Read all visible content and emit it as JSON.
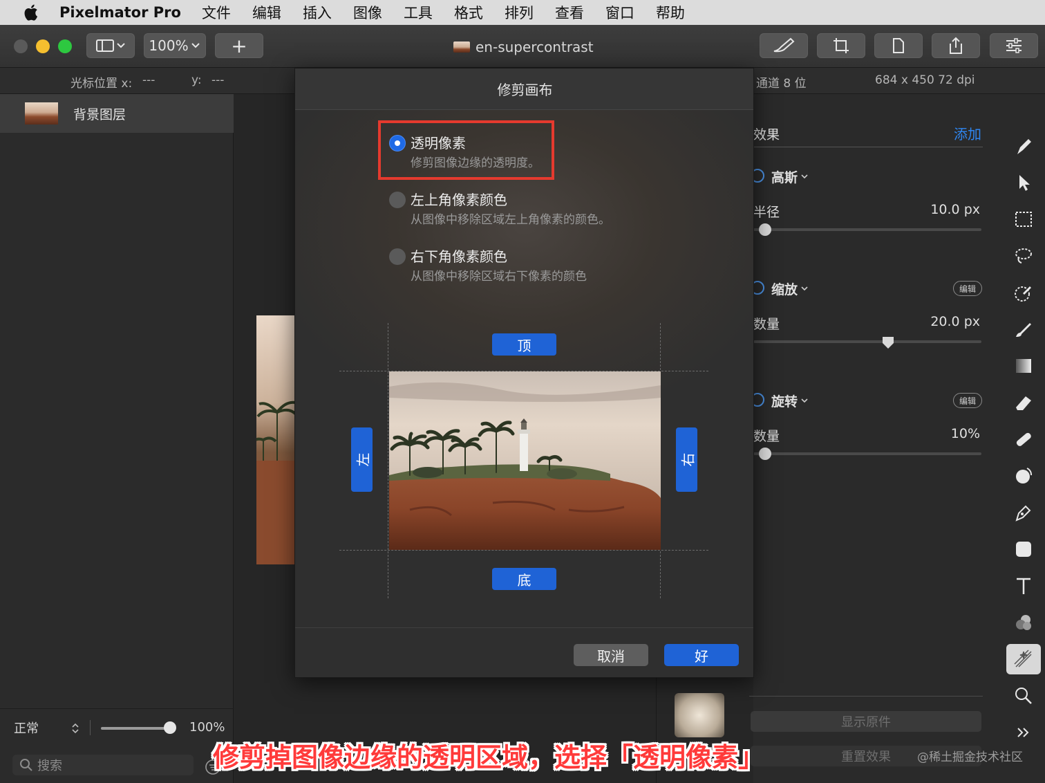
{
  "menubar": {
    "app_name": "Pixelmator Pro",
    "items": [
      "文件",
      "编辑",
      "插入",
      "图像",
      "工具",
      "格式",
      "排列",
      "查看",
      "窗口",
      "帮助"
    ]
  },
  "toolbar": {
    "zoom": "100%",
    "add_label": "+",
    "document_title": "en-supercontrast"
  },
  "infobar": {
    "cursor_x_label": "光标位置 x:",
    "cursor_x_value": "---",
    "cursor_y_label": "y:",
    "cursor_y_value": "---",
    "channel_info": "通道 8 位",
    "image_info": "684 x 450 72 dpi"
  },
  "layers": {
    "items": [
      {
        "label": "背景图层"
      }
    ],
    "blend_mode": "正常",
    "opacity": "100%",
    "opacity_fraction": 1.0,
    "search_placeholder": "搜索"
  },
  "dialog": {
    "title": "修剪画布",
    "options": [
      {
        "title": "透明像素",
        "desc": "修剪图像边缘的透明度。",
        "selected": true
      },
      {
        "title": "左上角像素颜色",
        "desc": "从图像中移除区域左上角像素的颜色。",
        "selected": false
      },
      {
        "title": "右下角像素颜色",
        "desc": "从图像中移除区域右下像素的颜色",
        "selected": false
      }
    ],
    "edges": {
      "top": "顶",
      "bottom": "底",
      "left": "左",
      "right": "右"
    },
    "cancel_label": "取消",
    "ok_label": "好"
  },
  "effects": {
    "header": "效果",
    "add_label": "添加",
    "edit_label": "编辑",
    "groups": [
      {
        "name": "高斯",
        "param_label": "半径",
        "param_value": "10.0 px",
        "level": 0.05
      },
      {
        "name": "缩放",
        "param_label": "数量",
        "param_value": "20.0 px",
        "level": 0.59
      },
      {
        "name": "旋转",
        "param_label": "数量",
        "param_value": "10%",
        "level": 0.05
      }
    ],
    "show_original_label": "显示原件",
    "reset_label": "重置效果"
  },
  "tools": [
    "paint-icon",
    "arrow-icon",
    "selection-icon",
    "lasso-icon",
    "color-picker-icon",
    "brush-icon",
    "gradient-icon",
    "eraser-icon",
    "bandage-icon",
    "distort-icon",
    "pen-icon",
    "shape-icon",
    "type-icon",
    "color-adjust-icon",
    "effects-icon",
    "zoom-icon",
    "more-icon"
  ],
  "caption": "修剪掉图像边缘的透明区域，选择「透明像素」",
  "watermark": "@稀土掘金技术社区",
  "colors": {
    "accent": "#1f63d6",
    "highlight_box": "#e53a2e",
    "caption": "#ff3a3a"
  }
}
